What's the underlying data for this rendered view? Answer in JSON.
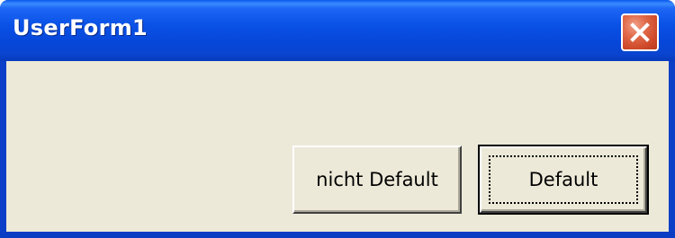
{
  "window": {
    "title": "UserForm1"
  },
  "titlebar": {
    "close_icon": "close-icon"
  },
  "buttons": {
    "non_default_label": "nicht Default",
    "default_label": "Default"
  },
  "colors": {
    "titlebar_blue": "#0a52e6",
    "client_background": "#ece9d8",
    "close_button_red": "#d9542f"
  }
}
